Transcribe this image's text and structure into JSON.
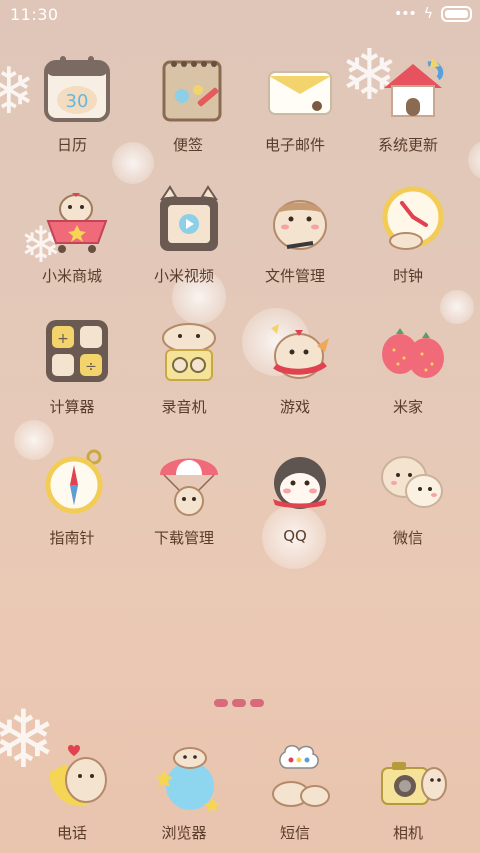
{
  "status_bar": {
    "time": "11:30",
    "signal_icon": "dots-icon",
    "charging_icon": "bolt-icon",
    "battery_icon": "battery-icon"
  },
  "apps": [
    {
      "label": "日历",
      "icon": "calendar-icon"
    },
    {
      "label": "便签",
      "icon": "notes-icon"
    },
    {
      "label": "电子邮件",
      "icon": "email-icon"
    },
    {
      "label": "系统更新",
      "icon": "system-update-icon"
    },
    {
      "label": "小米商城",
      "icon": "mi-store-icon"
    },
    {
      "label": "小米视频",
      "icon": "mi-video-icon"
    },
    {
      "label": "文件管理",
      "icon": "file-manager-icon"
    },
    {
      "label": "时钟",
      "icon": "clock-icon"
    },
    {
      "label": "计算器",
      "icon": "calculator-icon"
    },
    {
      "label": "录音机",
      "icon": "recorder-icon"
    },
    {
      "label": "游戏",
      "icon": "game-icon"
    },
    {
      "label": "米家",
      "icon": "mi-home-icon"
    },
    {
      "label": "指南针",
      "icon": "compass-icon"
    },
    {
      "label": "下载管理",
      "icon": "download-icon"
    },
    {
      "label": "QQ",
      "icon": "qq-icon"
    },
    {
      "label": "微信",
      "icon": "wechat-icon"
    }
  ],
  "dock": [
    {
      "label": "电话",
      "icon": "phone-icon"
    },
    {
      "label": "浏览器",
      "icon": "browser-icon"
    },
    {
      "label": "短信",
      "icon": "messages-icon"
    },
    {
      "label": "相机",
      "icon": "camera-icon"
    }
  ],
  "calendar_date": "30"
}
